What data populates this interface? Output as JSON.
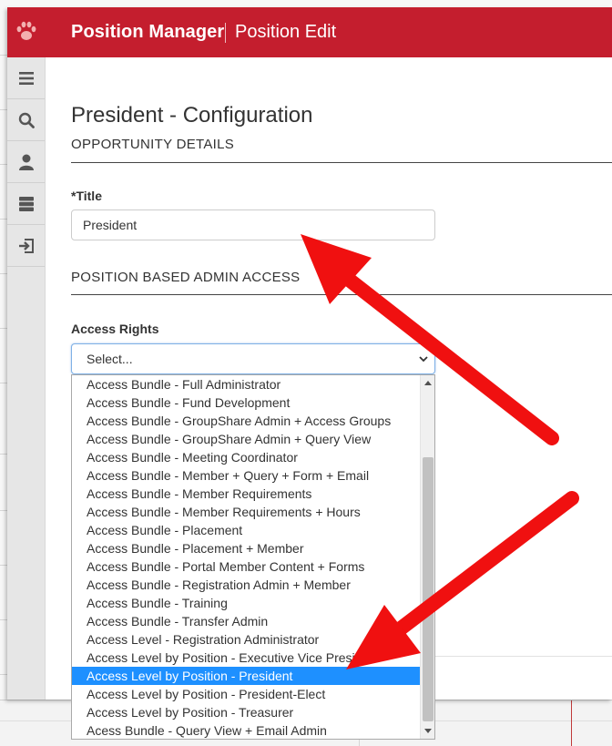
{
  "header": {
    "app_title": "Position Manager",
    "page_title": "Position Edit",
    "brand_color": "#c41e2e"
  },
  "leftnav": {
    "items": [
      {
        "icon": "menu-icon"
      },
      {
        "icon": "search-icon"
      },
      {
        "icon": "user-icon"
      },
      {
        "icon": "server-icon"
      },
      {
        "icon": "logout-icon"
      }
    ]
  },
  "main": {
    "config_title": "President - Configuration",
    "section_opportunity": "OPPORTUNITY DETAILS",
    "title_label": "*Title",
    "title_value": "President",
    "section_admin_access": "POSITION BASED ADMIN ACCESS",
    "access_rights_label": "Access Rights",
    "access_rights_value": "Select..."
  },
  "dropdown": {
    "selected_index": 16,
    "selected_color": "#1e90ff",
    "options": [
      "Access Bundle - Full Administrator",
      "Access Bundle - Fund Development",
      "Access Bundle - GroupShare Admin + Access Groups",
      "Access Bundle - GroupShare Admin + Query View",
      "Access Bundle - Meeting Coordinator",
      "Access Bundle - Member + Query + Form + Email",
      "Access Bundle - Member Requirements",
      "Access Bundle - Member Requirements + Hours",
      "Access Bundle - Placement",
      "Access Bundle - Placement + Member",
      "Access Bundle - Portal Member Content + Forms",
      "Access Bundle - Registration Admin + Member",
      "Access Bundle - Training",
      "Access Bundle - Transfer Admin",
      "Access Level - Registration Administrator",
      "Access Level by Position - Executive Vice President",
      "Access Level by Position - President",
      "Access Level by Position - President-Elect",
      "Access Level by Position - Treasurer",
      "Acess Bundle - Query View + Email Admin"
    ]
  },
  "annotation_color": "#f01010"
}
